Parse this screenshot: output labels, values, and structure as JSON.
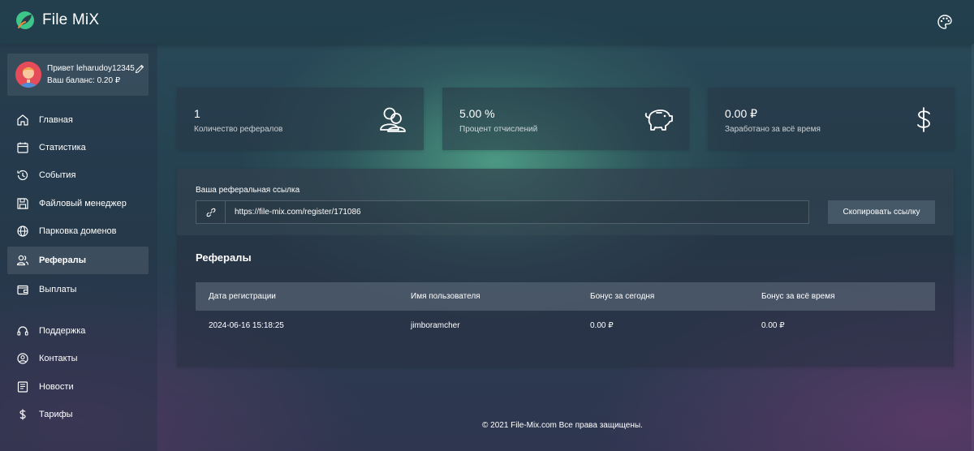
{
  "header": {
    "app_name": "File MiX",
    "theme_icon": "palette-icon"
  },
  "profile": {
    "greeting": "Привет leharudoy12345",
    "balance": "Ваш баланс: 0.20 ₽"
  },
  "sidebar": {
    "items": [
      {
        "label": "Главная",
        "icon": "home-icon",
        "active": false
      },
      {
        "label": "Статистика",
        "icon": "calendar-icon",
        "active": false
      },
      {
        "label": "События",
        "icon": "history-icon",
        "active": false
      },
      {
        "label": "Файловый менеджер",
        "icon": "save-icon",
        "active": false
      },
      {
        "label": "Парковка доменов",
        "icon": "globe-icon",
        "active": false
      },
      {
        "label": "Рефералы",
        "icon": "users-icon",
        "active": true
      },
      {
        "label": "Выплаты",
        "icon": "wallet-icon",
        "active": false
      },
      {
        "label": "Поддержка",
        "icon": "support-icon",
        "active": false
      },
      {
        "label": "Контакты",
        "icon": "contacts-icon",
        "active": false
      },
      {
        "label": "Новости",
        "icon": "news-icon",
        "active": false
      },
      {
        "label": "Тарифы",
        "icon": "dollar-icon",
        "active": false
      }
    ]
  },
  "stats": [
    {
      "value": "1",
      "label": "Количество рефералов",
      "icon": "users-icon"
    },
    {
      "value": "5.00 %",
      "label": "Процент отчислений",
      "icon": "piggy-bank-icon"
    },
    {
      "value": "0.00 ₽",
      "label": "Заработано за всё время",
      "icon": "dollar-icon"
    }
  ],
  "referral": {
    "link_label": "Ваша реферальная ссылка",
    "link_value": "https://file-mix.com/register/171086",
    "copy_label": "Скопировать ссылку"
  },
  "referrals_table": {
    "title": "Рефералы",
    "columns": [
      "Дата регистрации",
      "Имя пользователя",
      "Бонус за сегодня",
      "Бонус за всё время"
    ],
    "rows": [
      [
        "2024-06-16 15:18:25",
        "jimboramcher",
        "0.00 ₽",
        "0.00 ₽"
      ]
    ]
  },
  "footer": {
    "text": "© 2021 File-Mix.com Все права защищены."
  },
  "colors": {
    "accent_green": "#3ec58a",
    "accent_orange": "#f28a3a",
    "avatar_bg": "#e54b59"
  }
}
